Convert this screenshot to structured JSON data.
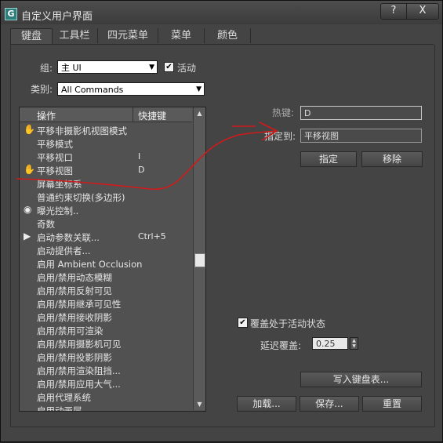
{
  "window": {
    "title": "自定义用户界面",
    "app_icon": "G",
    "help_label": "?",
    "close_label": "X"
  },
  "tabs": [
    "键盘",
    "工具栏",
    "四元菜单",
    "菜单",
    "颜色"
  ],
  "group": {
    "label": "组:",
    "value": "主 UI",
    "active_label": "活动",
    "active_checked": true
  },
  "category": {
    "label": "类别:",
    "value": "All Commands"
  },
  "list": {
    "col_action": "操作",
    "col_shortcut": "快捷键",
    "rows": [
      {
        "icon": "hand-icon",
        "name": "平移非摄影机视图模式",
        "key": ""
      },
      {
        "icon": "",
        "name": "平移模式",
        "key": ""
      },
      {
        "icon": "",
        "name": "平移视口",
        "key": "I"
      },
      {
        "icon": "hand-icon",
        "name": "平移视图",
        "key": "D"
      },
      {
        "icon": "",
        "name": "屏幕坐标系",
        "key": ""
      },
      {
        "icon": "",
        "name": "普通约束切换(多边形)",
        "key": ""
      },
      {
        "icon": "exposure-icon",
        "name": "曝光控制..",
        "key": ""
      },
      {
        "icon": "",
        "name": "奇数",
        "key": ""
      },
      {
        "icon": "wire-params-icon",
        "name": "启动参数关联...",
        "key": "Ctrl+5"
      },
      {
        "icon": "",
        "name": "启动提供者...",
        "key": ""
      },
      {
        "icon": "",
        "name": "启用 Ambient Occlusion",
        "key": ""
      },
      {
        "icon": "",
        "name": "启用/禁用动态模糊",
        "key": ""
      },
      {
        "icon": "",
        "name": "启用/禁用反射可见",
        "key": ""
      },
      {
        "icon": "",
        "name": "启用/禁用继承可见性",
        "key": ""
      },
      {
        "icon": "",
        "name": "启用/禁用接收阴影",
        "key": ""
      },
      {
        "icon": "",
        "name": "启用/禁用可渲染",
        "key": ""
      },
      {
        "icon": "",
        "name": "启用/禁用摄影机可见",
        "key": ""
      },
      {
        "icon": "",
        "name": "启用/禁用投影阴影",
        "key": ""
      },
      {
        "icon": "",
        "name": "启用/禁用渲染阻挡...",
        "key": ""
      },
      {
        "icon": "",
        "name": "启用/禁用应用大气...",
        "key": ""
      },
      {
        "icon": "",
        "name": "启用代理系统",
        "key": ""
      },
      {
        "icon": "",
        "name": "启用动画层",
        "key": ""
      }
    ]
  },
  "hotkey": {
    "label": "热键:",
    "value": "D"
  },
  "assigned": {
    "label": "指定到:",
    "value": "平移视图"
  },
  "buttons": {
    "assign": "指定",
    "remove": "移除",
    "write": "写入键盘表...",
    "load": "加载...",
    "save": "保存...",
    "reset": "重置"
  },
  "override": {
    "label": "覆盖处于活动状态",
    "checked": true,
    "delay_label": "延迟覆盖:",
    "delay_value": "0.25"
  },
  "annotation_color": "#d11a1a"
}
